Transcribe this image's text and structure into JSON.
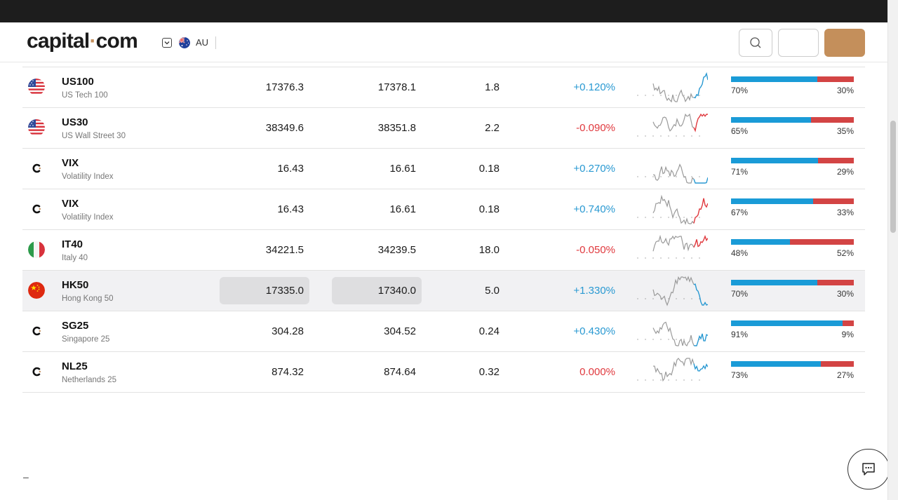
{
  "header": {
    "logo_left": "capital",
    "logo_dot": "·",
    "logo_right": "com",
    "locale_code": "AU",
    "icons": [
      "chevron-down-icon",
      "australia-flag-icon",
      "search-icon"
    ]
  },
  "colors": {
    "brand": "#c48f5b",
    "positive": "#2999d2",
    "negative": "#e0393e",
    "buy_bar": "#1a9bd7",
    "sell_bar": "#d34444"
  },
  "rows": [
    {
      "symbol": "US100",
      "name": "US Tech 100",
      "sell": "17376.3",
      "buy": "17378.1",
      "spread": "1.8",
      "change": "+0.120%",
      "direction": "up",
      "buy_pct": "70%",
      "sell_pct": "30%",
      "buy_fraction": 0.7,
      "icon": "us-flag-icon"
    },
    {
      "symbol": "US30",
      "name": "US Wall Street 30",
      "sell": "38349.6",
      "buy": "38351.8",
      "spread": "2.2",
      "change": "-0.090%",
      "direction": "down",
      "buy_pct": "65%",
      "sell_pct": "35%",
      "buy_fraction": 0.65,
      "icon": "us-flag-icon"
    },
    {
      "symbol": "VIX",
      "name": "Volatility Index",
      "sell": "16.43",
      "buy": "16.61",
      "spread": "0.18",
      "change": "+0.270%",
      "direction": "up",
      "buy_pct": "71%",
      "sell_pct": "29%",
      "buy_fraction": 0.71,
      "icon": "capital-logo-icon"
    },
    {
      "symbol": "VIX",
      "name": "Volatility Index",
      "sell": "16.43",
      "buy": "16.61",
      "spread": "0.18",
      "change": "+0.740%",
      "direction": "down",
      "buy_pct": "67%",
      "sell_pct": "33%",
      "buy_fraction": 0.67,
      "icon": "capital-logo-icon"
    },
    {
      "symbol": "IT40",
      "name": "Italy 40",
      "sell": "34221.5",
      "buy": "34239.5",
      "spread": "18.0",
      "change": "-0.050%",
      "direction": "down",
      "buy_pct": "48%",
      "sell_pct": "52%",
      "buy_fraction": 0.48,
      "icon": "italy-flag-icon"
    },
    {
      "symbol": "HK50",
      "name": "Hong Kong 50",
      "sell": "17335.0",
      "buy": "17340.0",
      "spread": "5.0",
      "change": "+1.330%",
      "direction": "up",
      "buy_pct": "70%",
      "sell_pct": "30%",
      "buy_fraction": 0.7,
      "icon": "china-flag-icon",
      "highlighted": true
    },
    {
      "symbol": "SG25",
      "name": "Singapore 25",
      "sell": "304.28",
      "buy": "304.52",
      "spread": "0.24",
      "change": "+0.430%",
      "direction": "up",
      "buy_pct": "91%",
      "sell_pct": "9%",
      "buy_fraction": 0.91,
      "icon": "capital-logo-icon"
    },
    {
      "symbol": "NL25",
      "name": "Netherlands 25",
      "sell": "874.32",
      "buy": "874.64",
      "spread": "0.32",
      "change": "0.000%",
      "direction": "up",
      "buy_pct": "73%",
      "sell_pct": "27%",
      "buy_fraction": 0.73,
      "icon": "capital-logo-icon"
    }
  ],
  "footer": {
    "dash": "–"
  }
}
